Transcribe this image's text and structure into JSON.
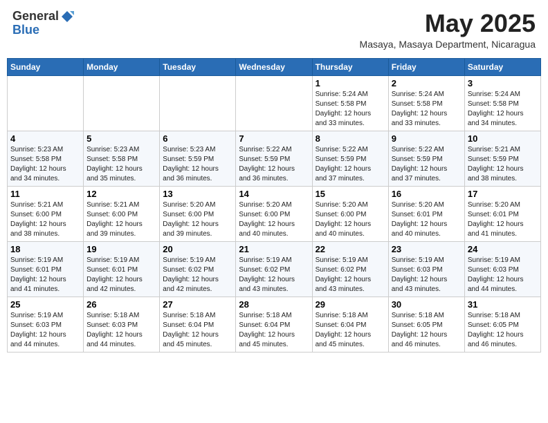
{
  "header": {
    "logo_general": "General",
    "logo_blue": "Blue",
    "month_title": "May 2025",
    "location": "Masaya, Masaya Department, Nicaragua"
  },
  "weekdays": [
    "Sunday",
    "Monday",
    "Tuesday",
    "Wednesday",
    "Thursday",
    "Friday",
    "Saturday"
  ],
  "weeks": [
    [
      {
        "day": "",
        "info": ""
      },
      {
        "day": "",
        "info": ""
      },
      {
        "day": "",
        "info": ""
      },
      {
        "day": "",
        "info": ""
      },
      {
        "day": "1",
        "info": "Sunrise: 5:24 AM\nSunset: 5:58 PM\nDaylight: 12 hours\nand 33 minutes."
      },
      {
        "day": "2",
        "info": "Sunrise: 5:24 AM\nSunset: 5:58 PM\nDaylight: 12 hours\nand 33 minutes."
      },
      {
        "day": "3",
        "info": "Sunrise: 5:24 AM\nSunset: 5:58 PM\nDaylight: 12 hours\nand 34 minutes."
      }
    ],
    [
      {
        "day": "4",
        "info": "Sunrise: 5:23 AM\nSunset: 5:58 PM\nDaylight: 12 hours\nand 34 minutes."
      },
      {
        "day": "5",
        "info": "Sunrise: 5:23 AM\nSunset: 5:58 PM\nDaylight: 12 hours\nand 35 minutes."
      },
      {
        "day": "6",
        "info": "Sunrise: 5:23 AM\nSunset: 5:59 PM\nDaylight: 12 hours\nand 36 minutes."
      },
      {
        "day": "7",
        "info": "Sunrise: 5:22 AM\nSunset: 5:59 PM\nDaylight: 12 hours\nand 36 minutes."
      },
      {
        "day": "8",
        "info": "Sunrise: 5:22 AM\nSunset: 5:59 PM\nDaylight: 12 hours\nand 37 minutes."
      },
      {
        "day": "9",
        "info": "Sunrise: 5:22 AM\nSunset: 5:59 PM\nDaylight: 12 hours\nand 37 minutes."
      },
      {
        "day": "10",
        "info": "Sunrise: 5:21 AM\nSunset: 5:59 PM\nDaylight: 12 hours\nand 38 minutes."
      }
    ],
    [
      {
        "day": "11",
        "info": "Sunrise: 5:21 AM\nSunset: 6:00 PM\nDaylight: 12 hours\nand 38 minutes."
      },
      {
        "day": "12",
        "info": "Sunrise: 5:21 AM\nSunset: 6:00 PM\nDaylight: 12 hours\nand 39 minutes."
      },
      {
        "day": "13",
        "info": "Sunrise: 5:20 AM\nSunset: 6:00 PM\nDaylight: 12 hours\nand 39 minutes."
      },
      {
        "day": "14",
        "info": "Sunrise: 5:20 AM\nSunset: 6:00 PM\nDaylight: 12 hours\nand 40 minutes."
      },
      {
        "day": "15",
        "info": "Sunrise: 5:20 AM\nSunset: 6:00 PM\nDaylight: 12 hours\nand 40 minutes."
      },
      {
        "day": "16",
        "info": "Sunrise: 5:20 AM\nSunset: 6:01 PM\nDaylight: 12 hours\nand 40 minutes."
      },
      {
        "day": "17",
        "info": "Sunrise: 5:20 AM\nSunset: 6:01 PM\nDaylight: 12 hours\nand 41 minutes."
      }
    ],
    [
      {
        "day": "18",
        "info": "Sunrise: 5:19 AM\nSunset: 6:01 PM\nDaylight: 12 hours\nand 41 minutes."
      },
      {
        "day": "19",
        "info": "Sunrise: 5:19 AM\nSunset: 6:01 PM\nDaylight: 12 hours\nand 42 minutes."
      },
      {
        "day": "20",
        "info": "Sunrise: 5:19 AM\nSunset: 6:02 PM\nDaylight: 12 hours\nand 42 minutes."
      },
      {
        "day": "21",
        "info": "Sunrise: 5:19 AM\nSunset: 6:02 PM\nDaylight: 12 hours\nand 43 minutes."
      },
      {
        "day": "22",
        "info": "Sunrise: 5:19 AM\nSunset: 6:02 PM\nDaylight: 12 hours\nand 43 minutes."
      },
      {
        "day": "23",
        "info": "Sunrise: 5:19 AM\nSunset: 6:03 PM\nDaylight: 12 hours\nand 43 minutes."
      },
      {
        "day": "24",
        "info": "Sunrise: 5:19 AM\nSunset: 6:03 PM\nDaylight: 12 hours\nand 44 minutes."
      }
    ],
    [
      {
        "day": "25",
        "info": "Sunrise: 5:19 AM\nSunset: 6:03 PM\nDaylight: 12 hours\nand 44 minutes."
      },
      {
        "day": "26",
        "info": "Sunrise: 5:18 AM\nSunset: 6:03 PM\nDaylight: 12 hours\nand 44 minutes."
      },
      {
        "day": "27",
        "info": "Sunrise: 5:18 AM\nSunset: 6:04 PM\nDaylight: 12 hours\nand 45 minutes."
      },
      {
        "day": "28",
        "info": "Sunrise: 5:18 AM\nSunset: 6:04 PM\nDaylight: 12 hours\nand 45 minutes."
      },
      {
        "day": "29",
        "info": "Sunrise: 5:18 AM\nSunset: 6:04 PM\nDaylight: 12 hours\nand 45 minutes."
      },
      {
        "day": "30",
        "info": "Sunrise: 5:18 AM\nSunset: 6:05 PM\nDaylight: 12 hours\nand 46 minutes."
      },
      {
        "day": "31",
        "info": "Sunrise: 5:18 AM\nSunset: 6:05 PM\nDaylight: 12 hours\nand 46 minutes."
      }
    ]
  ]
}
